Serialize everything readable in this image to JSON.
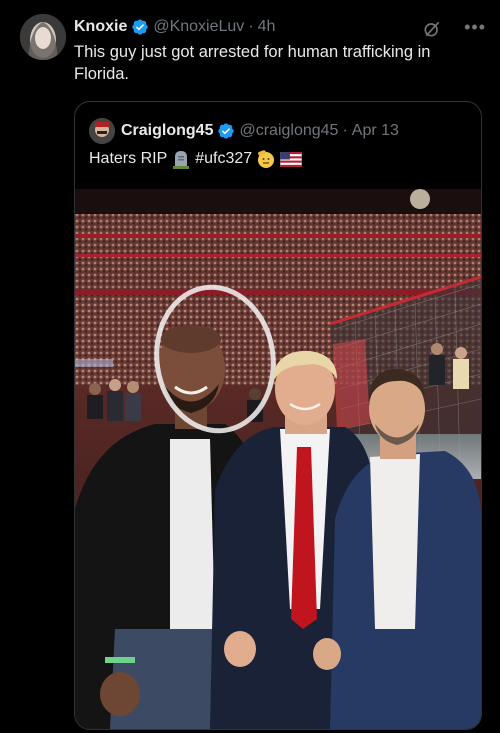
{
  "tweet": {
    "author_name": "Knoxie",
    "author_handle": "@KnoxieLuv",
    "separator": "·",
    "time": "4h",
    "text": "This guy just got arrested for human trafficking in Florida."
  },
  "quoted_tweet": {
    "author_name": "Craiglong45",
    "author_handle": "@craiglong45",
    "separator": "·",
    "date": "Apr 13",
    "text_prefix": "Haters RIP",
    "hashtag": "#ufc327"
  },
  "icons": {
    "verified": "verified-badge-icon",
    "grok": "grok-icon",
    "more": "more-options-icon",
    "headstone_emoji": "headstone-icon",
    "salute_emoji": "saluting-face-icon",
    "flag_emoji": "us-flag-icon"
  },
  "colors": {
    "background": "#000000",
    "text": "#e7e9ea",
    "secondary_text": "#71767b",
    "verified_blue": "#1d9bf0",
    "card_border": "#2f3336"
  }
}
